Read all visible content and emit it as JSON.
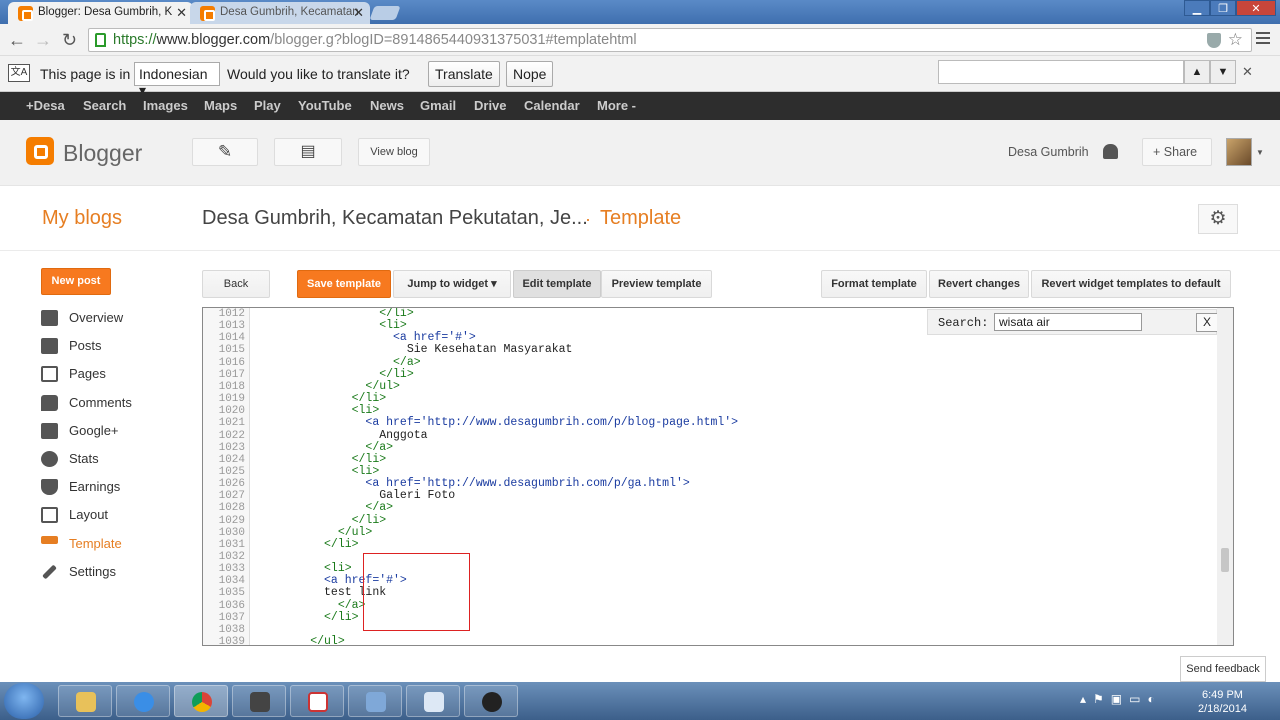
{
  "browser": {
    "tabs": [
      {
        "label": "Blogger: Desa Gumbrih, K"
      },
      {
        "label": "Desa Gumbrih, Kecamatan"
      }
    ],
    "url_scheme": "https://",
    "url_host": "www.blogger.com",
    "url_path": "/blogger.g?blogID=8914865440931375031#templatehtml"
  },
  "translate_bar": {
    "prefix": "This page is in",
    "language": "Indonesian",
    "question": "Would you like to translate it?",
    "translate_label": "Translate",
    "nope_label": "Nope"
  },
  "google_bar": [
    "+Desa",
    "Search",
    "Images",
    "Maps",
    "Play",
    "YouTube",
    "News",
    "Gmail",
    "Drive",
    "Calendar",
    "More -"
  ],
  "blogger_header": {
    "brand": "Blogger",
    "view_blog": "View blog",
    "user": "Desa Gumbrih",
    "share": "Share"
  },
  "title_row": {
    "my_blogs": "My blogs",
    "blog_name": "Desa Gumbrih, Kecamatan Pekutatan, Je...",
    "separator": "·",
    "section": "Template"
  },
  "sidebar": {
    "new_post": "New post",
    "items": [
      {
        "label": "Overview",
        "icon": "home-icon"
      },
      {
        "label": "Posts",
        "icon": "posts-icon"
      },
      {
        "label": "Pages",
        "icon": "pages-icon"
      },
      {
        "label": "Comments",
        "icon": "comments-icon"
      },
      {
        "label": "Google+",
        "icon": "google-plus-icon"
      },
      {
        "label": "Stats",
        "icon": "stats-icon"
      },
      {
        "label": "Earnings",
        "icon": "trophy-icon"
      },
      {
        "label": "Layout",
        "icon": "layout-icon"
      },
      {
        "label": "Template",
        "icon": "template-icon"
      },
      {
        "label": "Settings",
        "icon": "wrench-icon"
      }
    ]
  },
  "toolbar": {
    "back": "Back",
    "save_template": "Save template",
    "jump_to_widget": "Jump to widget",
    "edit_template": "Edit template",
    "preview_template": "Preview template",
    "format_template": "Format template",
    "revert_changes": "Revert changes",
    "revert_widgets": "Revert widget templates to default"
  },
  "editor": {
    "search_label": "Search:",
    "search_value": "wisata air",
    "close": "X",
    "line_numbers": [
      "1012",
      "1013",
      "1014",
      "1015",
      "1016",
      "1017",
      "1018",
      "1019",
      "1020",
      "1021",
      "1022",
      "1023",
      "1024",
      "1025",
      "1026",
      "1027",
      "1028",
      "1029",
      "1030",
      "1031",
      "1032",
      "1033",
      "1034",
      "1035",
      "1036",
      "1037",
      "1038",
      "1039"
    ],
    "lines": [
      "                  </li>",
      "                  <li>",
      "                    <a href='#'>",
      "                      Sie Kesehatan Masyarakat",
      "                    </a>",
      "                  </li>",
      "                </ul>",
      "              </li>",
      "              <li>",
      "                <a href='http://www.desagumbrih.com/p/blog-page.html'>",
      "                  Anggota",
      "                </a>",
      "              </li>",
      "              <li>",
      "                <a href='http://www.desagumbrih.com/p/ga.html'>",
      "                  Galeri Foto",
      "                </a>",
      "              </li>",
      "            </ul>",
      "          </li>",
      "",
      "          <li>",
      "          <a href='#'>",
      "          test link",
      "            </a>",
      "          </li>",
      "",
      "        </ul>"
    ]
  },
  "feedback": "Send feedback",
  "taskbar": {
    "time": "6:49 PM",
    "date": "2/18/2014"
  }
}
